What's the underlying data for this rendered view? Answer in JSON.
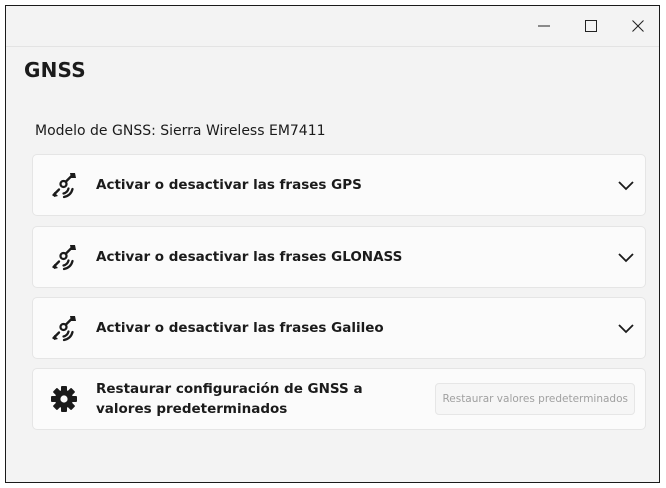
{
  "window": {
    "controls": {
      "minimize_icon": "minimize-icon",
      "maximize_icon": "maximize-icon",
      "close_icon": "close-icon"
    }
  },
  "page": {
    "title": "GNSS",
    "model_text": "Modelo de GNSS: Sierra Wireless EM7411"
  },
  "sections": [
    {
      "label": "Activar o desactivar las frases GPS",
      "icon": "satellite-icon",
      "expand_icon": "chevron-down-icon"
    },
    {
      "label": "Activar o desactivar las frases GLONASS",
      "icon": "satellite-icon",
      "expand_icon": "chevron-down-icon"
    },
    {
      "label": "Activar o desactivar las frases Galileo",
      "icon": "satellite-icon",
      "expand_icon": "chevron-down-icon"
    }
  ],
  "restore": {
    "label": "Restaurar configuración de GNSS a valores predeterminados",
    "button_label": "Restaurar valores predeterminados",
    "icon": "gear-icon",
    "button_enabled": false
  },
  "colors": {
    "background": "#f3f3f3",
    "card": "#fbfbfb",
    "text": "#1b1b1b",
    "disabled_text": "#a0a0a0"
  }
}
